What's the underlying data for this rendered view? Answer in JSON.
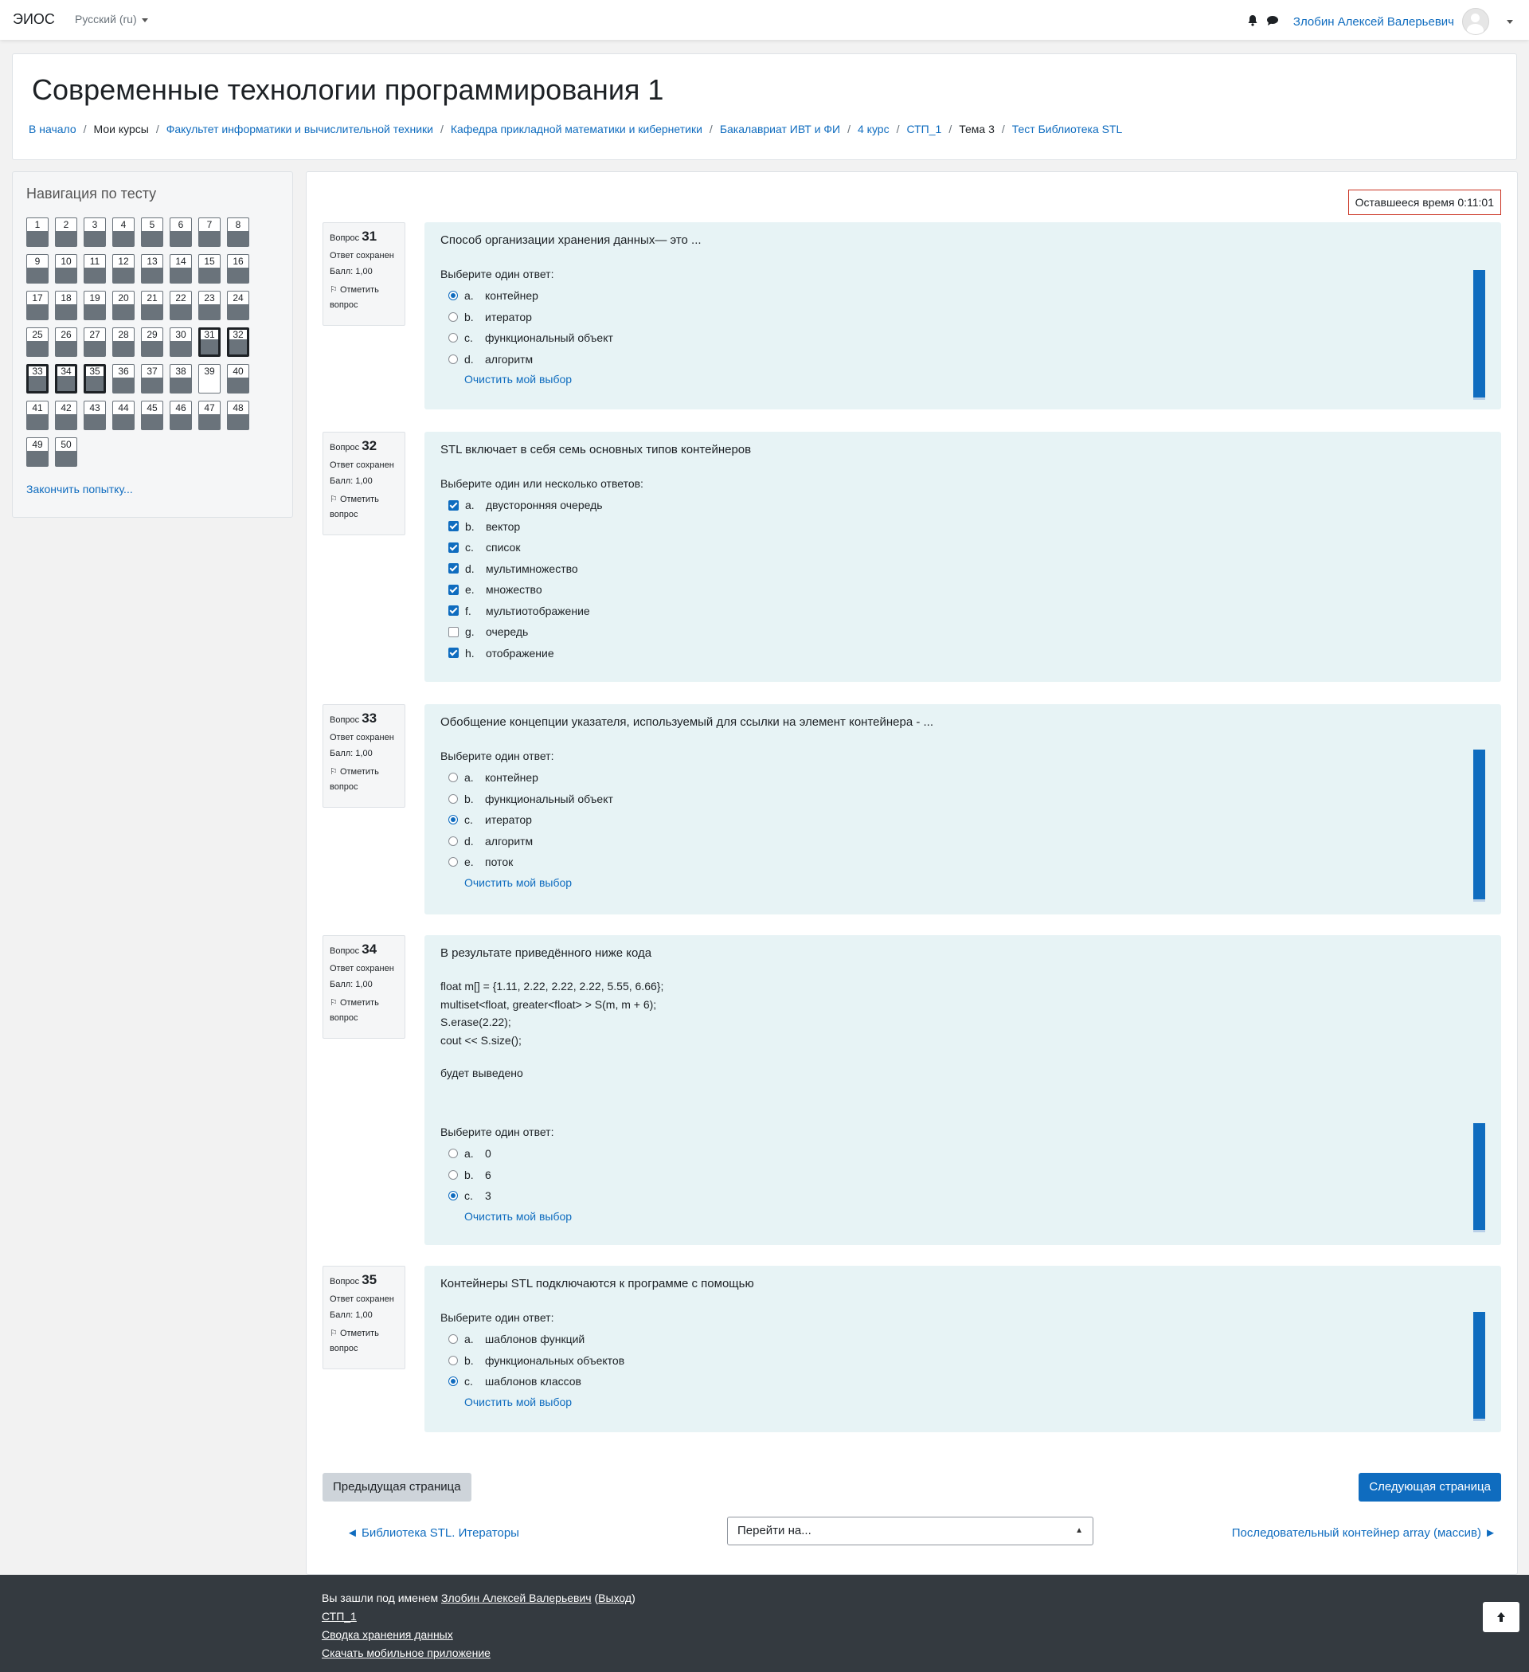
{
  "navbar": {
    "brand": "ЭИОС",
    "language": "Русский (ru)",
    "user_name": "Злобин Алексей Валерьевич",
    "icons": [
      "bell-icon",
      "chat-icon"
    ]
  },
  "header": {
    "course_title": "Современные технологии программирования 1",
    "breadcrumb": [
      {
        "label": "В начало",
        "link": true
      },
      {
        "label": "Мои курсы",
        "link": false
      },
      {
        "label": "Факультет информатики и вычислительной техники",
        "link": true
      },
      {
        "label": "Кафедра прикладной математики и кибернетики",
        "link": true
      },
      {
        "label": "Бакалавриат ИВТ и ФИ",
        "link": true
      },
      {
        "label": "4 курс",
        "link": true
      },
      {
        "label": "СТП_1",
        "link": true
      },
      {
        "label": "Тема 3",
        "link": false
      },
      {
        "label": "Тест Библиотека STL",
        "link": true
      }
    ]
  },
  "quiz_nav": {
    "title": "Навигация по тесту",
    "buttons": [
      {
        "n": "1",
        "answered": true
      },
      {
        "n": "2",
        "answered": true
      },
      {
        "n": "3",
        "answered": true
      },
      {
        "n": "4",
        "answered": true
      },
      {
        "n": "5",
        "answered": true
      },
      {
        "n": "6",
        "answered": true
      },
      {
        "n": "7",
        "answered": true
      },
      {
        "n": "8",
        "answered": true
      },
      {
        "n": "9",
        "answered": true
      },
      {
        "n": "10",
        "answered": true
      },
      {
        "n": "11",
        "answered": true
      },
      {
        "n": "12",
        "answered": true
      },
      {
        "n": "13",
        "answered": true
      },
      {
        "n": "14",
        "answered": true
      },
      {
        "n": "15",
        "answered": true
      },
      {
        "n": "16",
        "answered": true
      },
      {
        "n": "17",
        "answered": true
      },
      {
        "n": "18",
        "answered": true
      },
      {
        "n": "19",
        "answered": true
      },
      {
        "n": "20",
        "answered": true
      },
      {
        "n": "21",
        "answered": true
      },
      {
        "n": "22",
        "answered": true
      },
      {
        "n": "23",
        "answered": true
      },
      {
        "n": "24",
        "answered": true
      },
      {
        "n": "25",
        "answered": true
      },
      {
        "n": "26",
        "answered": true
      },
      {
        "n": "27",
        "answered": true
      },
      {
        "n": "28",
        "answered": true
      },
      {
        "n": "29",
        "answered": true
      },
      {
        "n": "30",
        "answered": true
      },
      {
        "n": "31",
        "answered": true,
        "current": true
      },
      {
        "n": "32",
        "answered": true,
        "current": true
      },
      {
        "n": "33",
        "answered": true,
        "current": true
      },
      {
        "n": "34",
        "answered": true,
        "current": true
      },
      {
        "n": "35",
        "answered": true,
        "current": true
      },
      {
        "n": "36",
        "answered": true
      },
      {
        "n": "37",
        "answered": true
      },
      {
        "n": "38",
        "answered": true
      },
      {
        "n": "39",
        "answered": false
      },
      {
        "n": "40",
        "answered": true
      },
      {
        "n": "41",
        "answered": true
      },
      {
        "n": "42",
        "answered": true
      },
      {
        "n": "43",
        "answered": true
      },
      {
        "n": "44",
        "answered": true
      },
      {
        "n": "45",
        "answered": true
      },
      {
        "n": "46",
        "answered": true
      },
      {
        "n": "47",
        "answered": true
      },
      {
        "n": "48",
        "answered": true
      },
      {
        "n": "49",
        "answered": true
      },
      {
        "n": "50",
        "answered": true
      }
    ],
    "finish_label": "Закончить попытку..."
  },
  "timer": {
    "label": "Оставшееся время",
    "value": "0:11:01"
  },
  "question_info": {
    "prefix": "Вопрос",
    "state": "Ответ сохранен",
    "mark": "Балл: 1,00",
    "flag": "Отметить вопрос"
  },
  "clear_label": "Очистить мой выбор",
  "questions": [
    {
      "number": "31",
      "text": "Способ организации хранения данных— это ...",
      "prompt": "Выберите один ответ:",
      "type": "radio",
      "answers": [
        {
          "letter": "a.",
          "text": "контейнер",
          "checked": true
        },
        {
          "letter": "b.",
          "text": "итератор",
          "checked": false
        },
        {
          "letter": "c.",
          "text": "функциональный объект",
          "checked": false
        },
        {
          "letter": "d.",
          "text": "алгоритм",
          "checked": false
        }
      ]
    },
    {
      "number": "32",
      "text": "STL включает в себя семь основных типов контейнеров",
      "prompt": "Выберите один или несколько ответов:",
      "type": "checkbox",
      "answers": [
        {
          "letter": "a.",
          "text": "двусторонняя очередь",
          "checked": true
        },
        {
          "letter": "b.",
          "text": "вектор",
          "checked": true
        },
        {
          "letter": "c.",
          "text": "список",
          "checked": true
        },
        {
          "letter": "d.",
          "text": "мультимножество",
          "checked": true
        },
        {
          "letter": "e.",
          "text": "множество",
          "checked": true
        },
        {
          "letter": "f.",
          "text": "мультиотображение",
          "checked": true
        },
        {
          "letter": "g.",
          "text": "очередь",
          "checked": false
        },
        {
          "letter": "h.",
          "text": "отображение",
          "checked": true
        }
      ]
    },
    {
      "number": "33",
      "text": "Обобщение концепции указателя, используемый для ссылки на элемент контейнера - ...",
      "prompt": "Выберите один ответ:",
      "type": "radio",
      "answers": [
        {
          "letter": "a.",
          "text": "контейнер",
          "checked": false
        },
        {
          "letter": "b.",
          "text": "функциональный объект",
          "checked": false
        },
        {
          "letter": "c.",
          "text": "итератор",
          "checked": true
        },
        {
          "letter": "d.",
          "text": "алгоритм",
          "checked": false
        },
        {
          "letter": "e.",
          "text": "поток",
          "checked": false
        }
      ]
    },
    {
      "number": "34",
      "text": "В результате приведённого ниже кода",
      "code": [
        "float m[] = {1.11, 2.22, 2.22, 2.22, 5.55, 6.66};",
        "multiset<float, greater<float> > S(m, m + 6);",
        "S.erase(2.22);",
        "cout << S.size();"
      ],
      "after_code": "будет выведено",
      "prompt": "Выберите один ответ:",
      "type": "radio",
      "answers": [
        {
          "letter": "a.",
          "text": "0",
          "checked": false
        },
        {
          "letter": "b.",
          "text": "6",
          "checked": false
        },
        {
          "letter": "c.",
          "text": "3",
          "checked": true
        }
      ]
    },
    {
      "number": "35",
      "text": "Контейнеры STL подключаются к программе с помощью",
      "prompt": "Выберите один ответ:",
      "type": "radio",
      "answers": [
        {
          "letter": "a.",
          "text": "шаблонов функций",
          "checked": false
        },
        {
          "letter": "b.",
          "text": "функциональных объектов",
          "checked": false
        },
        {
          "letter": "c.",
          "text": "шаблонов классов",
          "checked": true
        }
      ]
    }
  ],
  "buttons": {
    "prev_page": "Предыдущая страница",
    "next_page": "Следующая страница"
  },
  "activity_nav": {
    "prev": "◄ Библиотека STL. Итераторы",
    "jump": "Перейти на...",
    "next": "Последовательный контейнер array (массив) ►"
  },
  "footer": {
    "logged_in_prefix": "Вы зашли под именем",
    "user": "Злобин Алексей Валерьевич",
    "logout": "Выход",
    "links": [
      "СТП_1",
      "Сводка хранения данных",
      "Скачать мобильное приложение"
    ]
  },
  "colors": {
    "primary": "#0f6cbf",
    "question_bg": "#e7f3f5",
    "footer_bg": "#343a40",
    "timer_border": "#ca3120"
  }
}
